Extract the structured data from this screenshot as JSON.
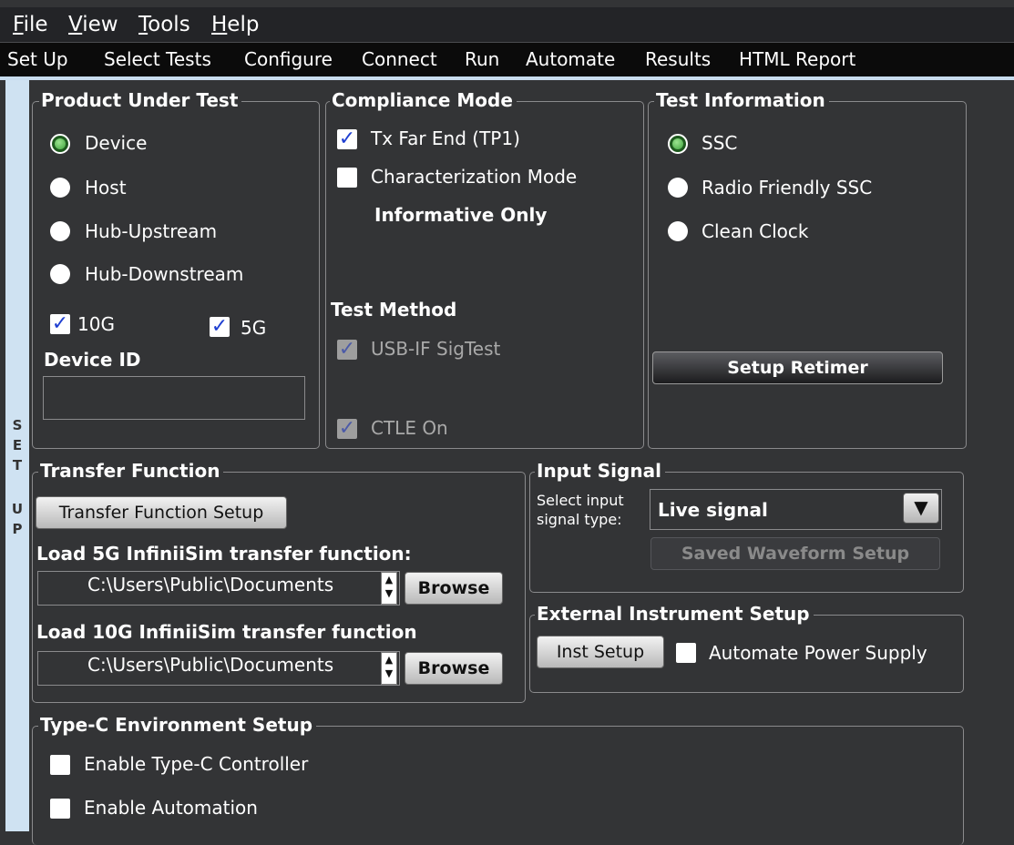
{
  "menu": [
    {
      "label": "File",
      "underline": "F",
      "rest": "ile"
    },
    {
      "label": "View",
      "underline": "V",
      "rest": "iew"
    },
    {
      "label": "Tools",
      "underline": "T",
      "rest": "ools"
    },
    {
      "label": "Help",
      "underline": "H",
      "rest": "elp"
    }
  ],
  "tabs": [
    "Set Up",
    "Select Tests",
    "Configure",
    "Connect",
    "Run",
    "Automate",
    "Results",
    "HTML Report"
  ],
  "side_letters": [
    "S",
    "E",
    "T",
    "U",
    "P"
  ],
  "product": {
    "title": "Product Under Test",
    "radios": [
      {
        "label": "Device",
        "selected": true
      },
      {
        "label": "Host",
        "selected": false
      },
      {
        "label": "Hub-Upstream",
        "selected": false
      },
      {
        "label": "Hub-Downstream",
        "selected": false
      }
    ],
    "check_10g": {
      "label": "10G",
      "checked": true
    },
    "check_5g": {
      "label": "5G",
      "checked": true
    },
    "device_id_label": "Device ID",
    "device_id_value": ""
  },
  "compliance": {
    "title": "Compliance Mode",
    "tx_far_end": {
      "label": "Tx Far End (TP1)",
      "checked": true
    },
    "characterization": {
      "label": "Characterization Mode",
      "checked": false
    },
    "informative": "Informative Only",
    "test_method_label": "Test Method",
    "sigtest": {
      "label": "USB-IF SigTest",
      "checked": true,
      "disabled": true
    },
    "ctle": {
      "label": "CTLE On",
      "checked": true,
      "disabled": true
    }
  },
  "test_info": {
    "title": "Test Information",
    "radios": [
      {
        "label": "SSC",
        "selected": true
      },
      {
        "label": "Radio Friendly SSC",
        "selected": false
      },
      {
        "label": "Clean Clock",
        "selected": false
      }
    ],
    "setup_retimer": "Setup Retimer"
  },
  "transfer": {
    "title": "Transfer Function",
    "setup_button": "Transfer Function Setup",
    "load5g_label": "Load 5G InfiniiSim transfer function:",
    "load5g_path": "C:\\Users\\Public\\Documents",
    "load10g_label": "Load 10G InfiniiSim transfer function",
    "load10g_path": "C:\\Users\\Public\\Documents",
    "browse": "Browse"
  },
  "input_signal": {
    "title": "Input Signal",
    "select_label_1": "Select input",
    "select_label_2": "signal type:",
    "selected_value": "Live signal",
    "saved_waveform": "Saved Waveform Setup"
  },
  "external": {
    "title": "External Instrument Setup",
    "inst_setup": "Inst Setup",
    "automate_power": {
      "label": "Automate Power Supply",
      "checked": false
    }
  },
  "typec": {
    "title": "Type-C Environment Setup",
    "enable_controller": {
      "label": "Enable Type-C Controller",
      "checked": false
    },
    "enable_automation": {
      "label": "Enable Automation",
      "checked": false
    }
  },
  "colors": {
    "background": "#333436",
    "checkmark": "#1f3fd1",
    "radio_on": "#3ea33c",
    "accent_strip": "#cfe2f2"
  }
}
